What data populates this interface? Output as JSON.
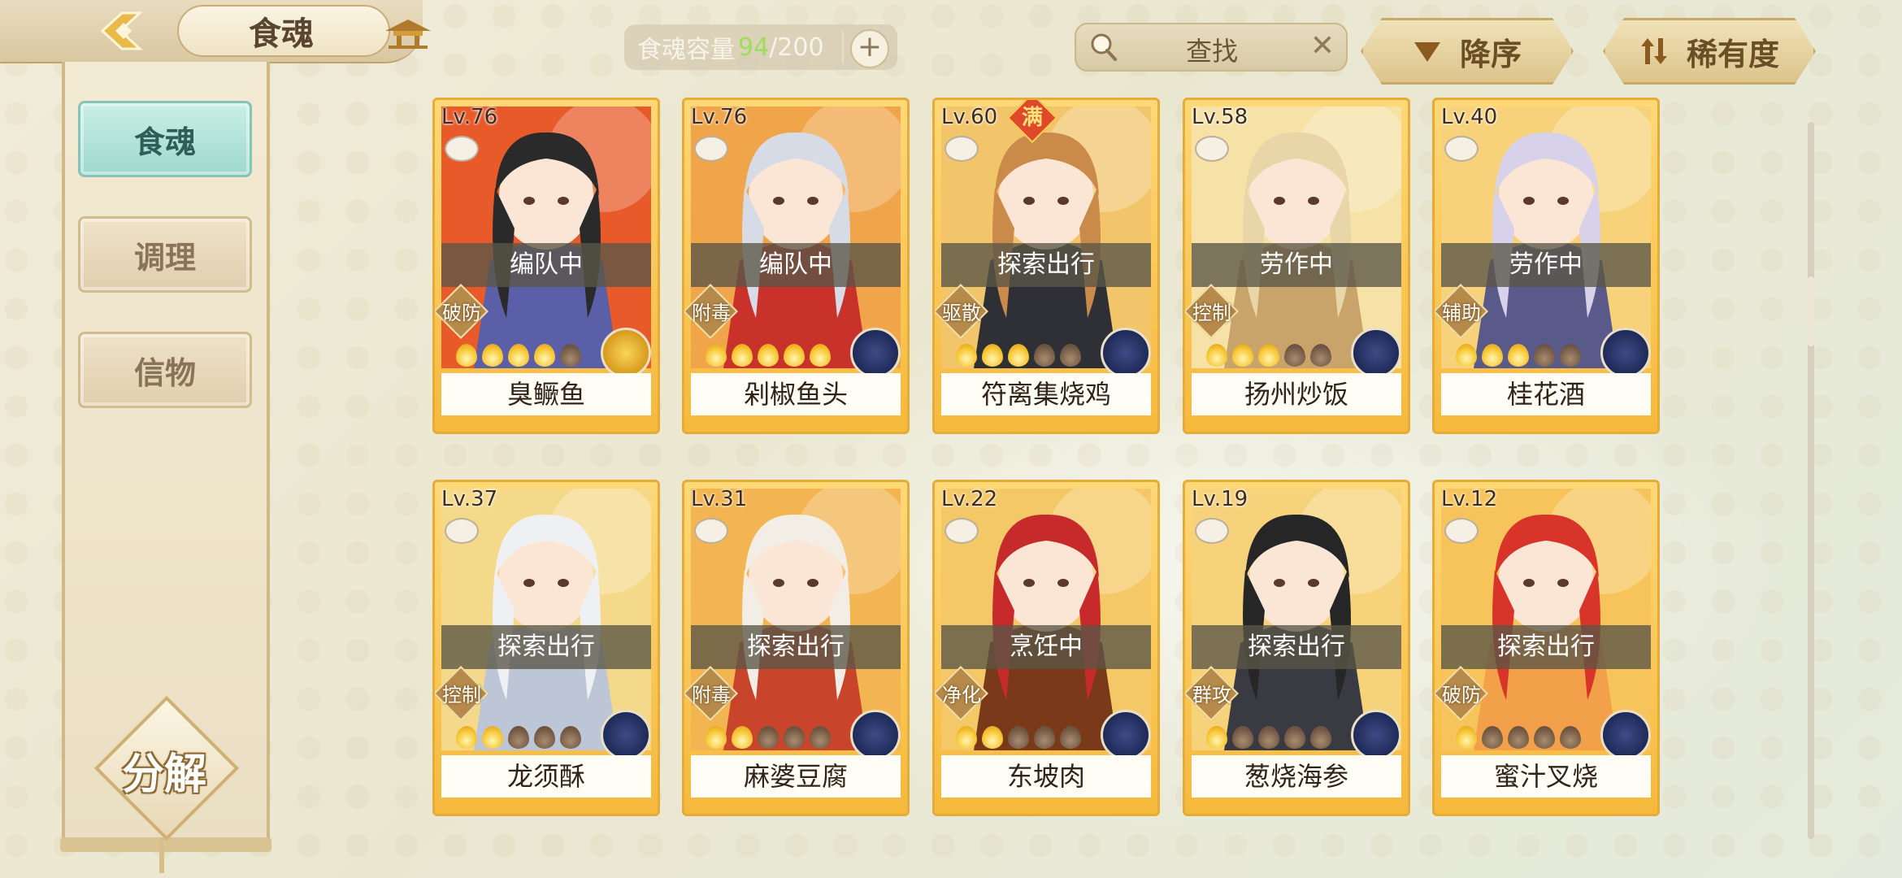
{
  "header": {
    "title": "食魂",
    "capacity_label": "食魂容量",
    "capacity_current": "94",
    "capacity_max": "/200",
    "add_label": "+",
    "search_placeholder": "查找",
    "clear_label": "✕",
    "sort_order_label": "降序",
    "sort_field_label": "稀有度"
  },
  "sidebar": {
    "tabs": [
      {
        "label": "食魂",
        "active": true
      },
      {
        "label": "调理",
        "active": false
      },
      {
        "label": "信物",
        "active": false
      }
    ],
    "decompose_label": "分解"
  },
  "cards": [
    {
      "level": "Lv.76",
      "status": "编队中",
      "role": "破防",
      "name": "臭鳜鱼",
      "stars": 4,
      "emblem": "gold",
      "full": false,
      "palette": [
        "#e85a2a",
        "#2a2a2a",
        "#5a5fa8"
      ]
    },
    {
      "level": "Lv.76",
      "status": "编队中",
      "role": "附毒",
      "name": "剁椒鱼头",
      "stars": 5,
      "emblem": "navy",
      "full": false,
      "palette": [
        "#f0a54a",
        "#d7dbe6",
        "#c8322a"
      ]
    },
    {
      "level": "Lv.60",
      "status": "探索出行",
      "role": "驱散",
      "name": "符离集烧鸡",
      "stars": 3,
      "emblem": "navy",
      "full": true,
      "full_label": "满",
      "palette": [
        "#f2c56b",
        "#c98a4a",
        "#2f2f36"
      ]
    },
    {
      "level": "Lv.58",
      "status": "劳作中",
      "role": "控制",
      "name": "扬州炒饭",
      "stars": 3,
      "emblem": "navy",
      "full": false,
      "palette": [
        "#f6e2a6",
        "#e8d6a8",
        "#c9a46a"
      ]
    },
    {
      "level": "Lv.40",
      "status": "劳作中",
      "role": "辅助",
      "name": "桂花酒",
      "stars": 3,
      "emblem": "navy",
      "full": false,
      "palette": [
        "#f7d27a",
        "#d7d2ea",
        "#5a5a8a"
      ]
    },
    {
      "level": "Lv.37",
      "status": "探索出行",
      "role": "控制",
      "name": "龙须酥",
      "stars": 2,
      "emblem": "navy",
      "full": false,
      "palette": [
        "#f5d98a",
        "#eef0f4",
        "#bcc6d6"
      ]
    },
    {
      "level": "Lv.31",
      "status": "探索出行",
      "role": "附毒",
      "name": "麻婆豆腐",
      "stars": 2,
      "emblem": "navy",
      "full": false,
      "palette": [
        "#f2b552",
        "#f2eee6",
        "#c8442a"
      ]
    },
    {
      "level": "Lv.22",
      "status": "烹饪中",
      "role": "净化",
      "name": "东坡肉",
      "stars": 2,
      "emblem": "navy",
      "full": false,
      "palette": [
        "#f4c866",
        "#c72a2a",
        "#7a3a1a"
      ]
    },
    {
      "level": "Lv.19",
      "status": "探索出行",
      "role": "群攻",
      "name": "葱烧海参",
      "stars": 1,
      "emblem": "navy",
      "full": false,
      "palette": [
        "#f6d27a",
        "#262626",
        "#3a3a42"
      ]
    },
    {
      "level": "Lv.12",
      "status": "探索出行",
      "role": "破防",
      "name": "蜜汁叉烧",
      "stars": 1,
      "emblem": "navy",
      "full": false,
      "palette": [
        "#f6c45a",
        "#d9342a",
        "#f2a04a"
      ]
    }
  ]
}
